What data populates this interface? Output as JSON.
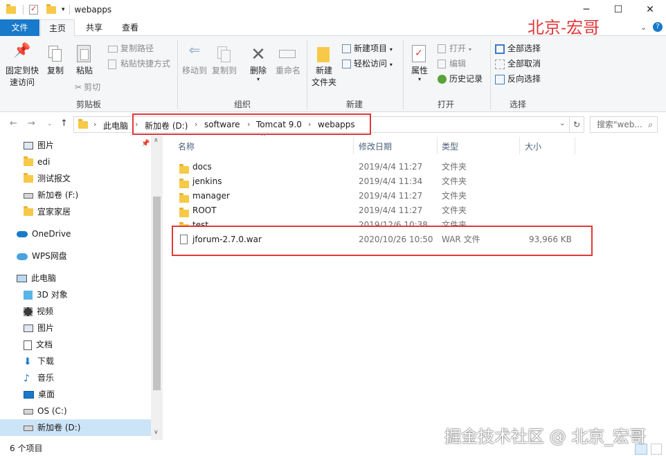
{
  "window": {
    "title": "webapps"
  },
  "tabs": [
    {
      "label": "文件"
    },
    {
      "label": "主页"
    },
    {
      "label": "共享"
    },
    {
      "label": "查看"
    }
  ],
  "ribbon": {
    "clipboard": {
      "pin": "固定到快",
      "pin2": "速访问",
      "copy": "复制",
      "paste": "粘贴",
      "copy_path": "复制路径",
      "paste_shortcut": "粘贴快捷方式",
      "cut": "剪切",
      "label": "剪贴板"
    },
    "organize": {
      "move_to": "移动到",
      "copy_to": "复制到",
      "delete": "删除",
      "rename": "重命名",
      "label": "组织"
    },
    "new": {
      "new_folder": "新建",
      "new_folder2": "文件夹",
      "new_item": "新建项目",
      "easy_access": "轻松访问",
      "label": "新建"
    },
    "open": {
      "properties": "属性",
      "open": "打开",
      "edit": "编辑",
      "history": "历史记录",
      "label": "打开"
    },
    "select": {
      "select_all": "全部选择",
      "select_none": "全部取消",
      "invert": "反向选择",
      "label": "选择"
    }
  },
  "address": {
    "crumbs": [
      "此电脑",
      "新加卷 (D:)",
      "software",
      "Tomcat 9.0",
      "webapps"
    ],
    "search_placeholder": "搜索\"web..."
  },
  "nav": {
    "items": [
      {
        "label": "图片",
        "icon": "pictures-icon"
      },
      {
        "label": "edi",
        "icon": "folder-icon"
      },
      {
        "label": "测试报文",
        "icon": "folder-icon"
      },
      {
        "label": "新加卷 (F:)",
        "icon": "drive-icon"
      },
      {
        "label": "宜家家居",
        "icon": "folder-icon"
      },
      {
        "label": "OneDrive",
        "icon": "onedrive-icon"
      },
      {
        "label": "WPS网盘",
        "icon": "wps-cloud-icon"
      },
      {
        "label": "此电脑",
        "icon": "computer-icon"
      },
      {
        "label": "3D 对象",
        "icon": "3d-objects-icon"
      },
      {
        "label": "视频",
        "icon": "videos-icon"
      },
      {
        "label": "图片",
        "icon": "pictures-icon"
      },
      {
        "label": "文档",
        "icon": "documents-icon"
      },
      {
        "label": "下载",
        "icon": "downloads-icon"
      },
      {
        "label": "音乐",
        "icon": "music-icon"
      },
      {
        "label": "桌面",
        "icon": "desktop-icon"
      },
      {
        "label": "OS (C:)",
        "icon": "drive-icon"
      },
      {
        "label": "新加卷 (D:)",
        "icon": "drive-icon"
      }
    ]
  },
  "columns": {
    "name": "名称",
    "modified": "修改日期",
    "type": "类型",
    "size": "大小"
  },
  "files": [
    {
      "name": "docs",
      "date": "2019/4/4 11:27",
      "type": "文件夹",
      "size": ""
    },
    {
      "name": "jenkins",
      "date": "2019/4/4 11:34",
      "type": "文件夹",
      "size": ""
    },
    {
      "name": "manager",
      "date": "2019/4/4 11:27",
      "type": "文件夹",
      "size": ""
    },
    {
      "name": "ROOT",
      "date": "2019/4/4 11:27",
      "type": "文件夹",
      "size": ""
    },
    {
      "name": "test",
      "date": "2019/12/6 10:38",
      "type": "文件夹",
      "size": ""
    },
    {
      "name": "jforum-2.7.0.war",
      "date": "2020/10/26 10:50",
      "type": "WAR 文件",
      "size": "93,966 KB"
    }
  ],
  "status": {
    "count": "6 个项目"
  },
  "watermarks": {
    "top": "北京-宏哥",
    "bottom": "掘金技术社区 @ 北京_宏哥"
  },
  "colors": {
    "accent": "#1979ca",
    "highlight": "#e0373a",
    "folder": "#f7c948"
  }
}
